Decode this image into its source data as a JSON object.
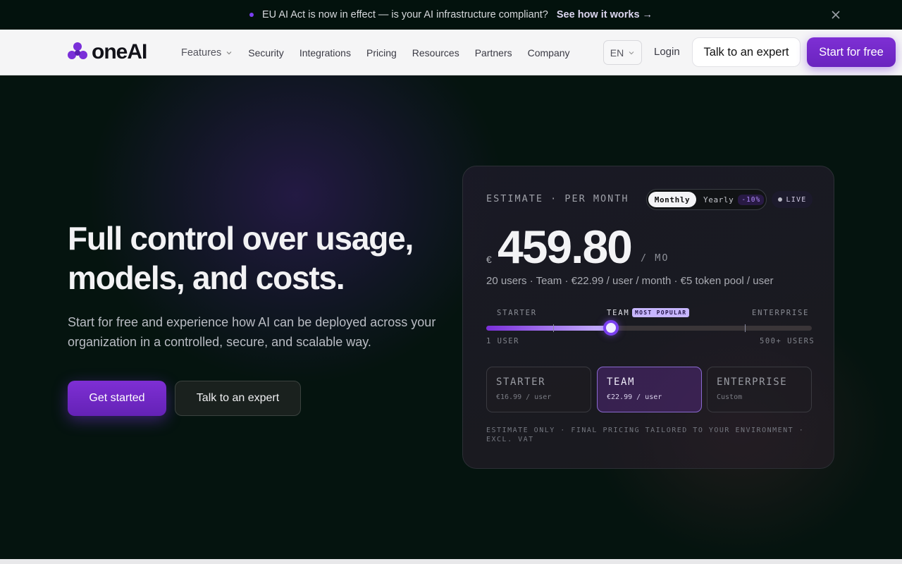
{
  "announcement": {
    "message": "EU AI Act is now in effect — is your AI infrastructure compliant?",
    "link": "See how it works →"
  },
  "nav": {
    "logo_text": "oneAI",
    "items": [
      "Features",
      "Security",
      "Integrations",
      "Pricing",
      "Resources",
      "Partners",
      "Company"
    ],
    "language": "EN",
    "login": "Login",
    "talk_expert": "Talk to an expert",
    "start_free": "Start for free"
  },
  "hero": {
    "headline_line1": "Full control over usage,",
    "headline_line2": "models, and costs.",
    "subtext": "Start for free and experience how AI can be deployed across your organization in a controlled, secure, and scalable way.",
    "cta_primary": "Get started",
    "cta_secondary": "Talk to an expert"
  },
  "estimate": {
    "label": "ESTIMATE · PER MONTH",
    "toggle_monthly": "Monthly",
    "toggle_yearly": "Yearly",
    "yearly_discount": "-10%",
    "live": "LIVE",
    "currency": "€",
    "price": "459.80",
    "period": "/ MO",
    "detail": "20 users · Team · €22.99 / user / month · €5 token pool / user",
    "slider": {
      "label_starter": "STARTER",
      "label_team": "TEAM",
      "label_enterprise": "ENTERPRISE",
      "badge": "MOST POPULAR",
      "min_label": "1 USER",
      "max_label": "500+ USERS",
      "value_fraction": 0.383
    },
    "plans": [
      {
        "name": "STARTER",
        "price": "€16.99 / user"
      },
      {
        "name": "TEAM",
        "price": "€22.99 / user"
      },
      {
        "name": "ENTERPRISE",
        "price": "Custom"
      }
    ],
    "disclaimer": "ESTIMATE ONLY · FINAL PRICING TAILORED TO YOUR ENVIRONMENT · EXCL. VAT"
  },
  "colors": {
    "accent": "#7a3ff0",
    "background": "#05140f",
    "nav_background": "#f5f5f6"
  }
}
